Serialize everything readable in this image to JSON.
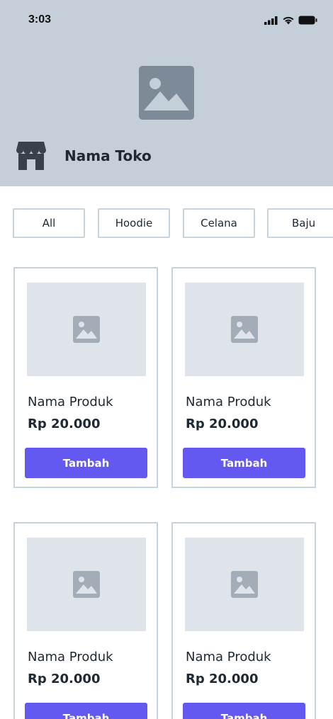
{
  "status_bar": {
    "time": "3:03",
    "signal_icon": "signal-icon",
    "wifi_icon": "wifi-icon",
    "battery_icon": "battery-icon"
  },
  "header": {
    "banner_icon": "image-placeholder-icon",
    "store_icon": "store-icon",
    "store_name": "Nama Toko"
  },
  "filters": [
    "All",
    "Hoodie",
    "Celana",
    "Baju"
  ],
  "products": [
    {
      "name": "Nama Produk",
      "price": "Rp 20.000",
      "button": "Tambah"
    },
    {
      "name": "Nama Produk",
      "price": "Rp 20.000",
      "button": "Tambah"
    },
    {
      "name": "Nama Produk",
      "price": "Rp 20.000",
      "button": "Tambah"
    },
    {
      "name": "Nama Produk",
      "price": "Rp 20.000",
      "button": "Tambah"
    }
  ],
  "colors": {
    "header_bg": "#c4cfd9",
    "accent": "#6358f0",
    "placeholder_bg": "#dfe4ea",
    "border": "#c9d3dc"
  }
}
